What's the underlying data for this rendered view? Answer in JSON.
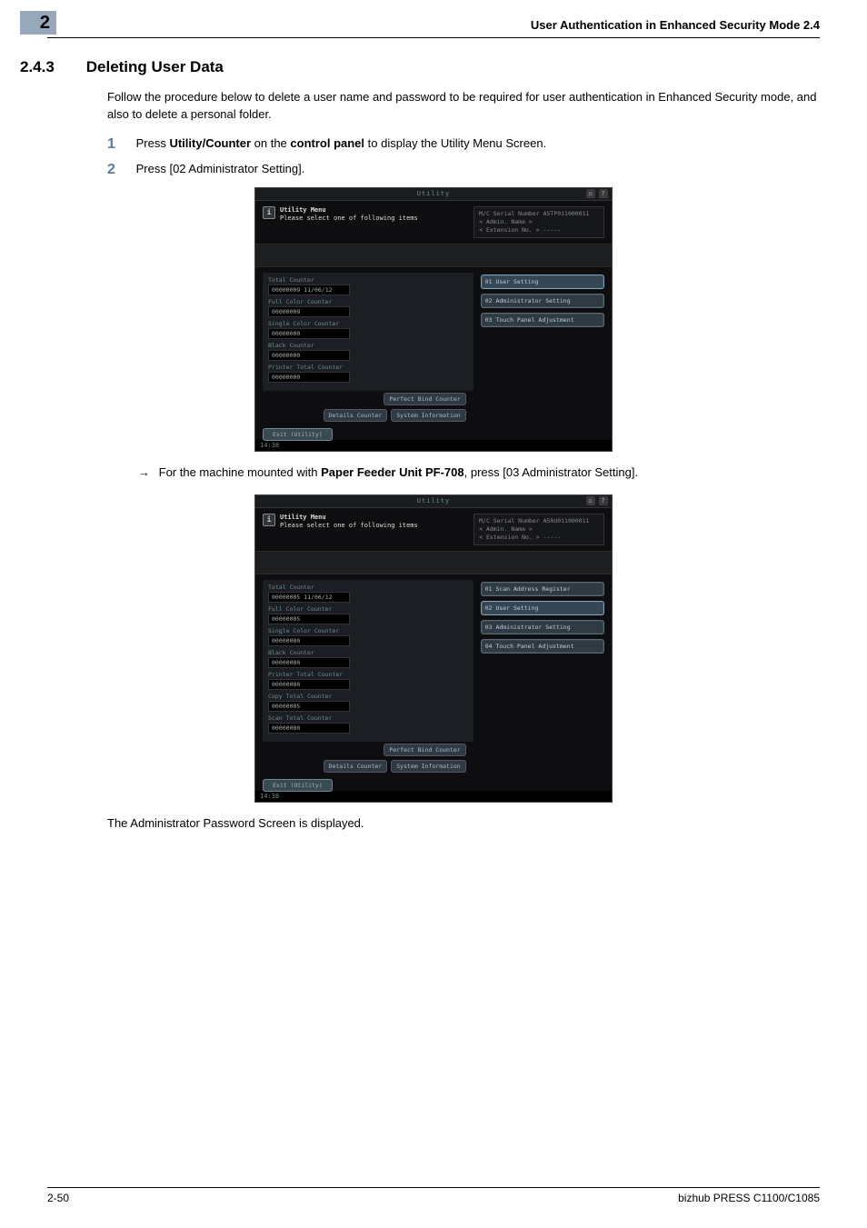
{
  "chapter_number": "2",
  "running_header": "User Authentication in Enhanced Security Mode    2.4",
  "section_number": "2.4.3",
  "section_title": "Deleting User Data",
  "intro": "Follow the procedure below to delete a user name and password to be required for user authentication in Enhanced Security mode, and also to delete a personal folder.",
  "step1_num": "1",
  "step1": {
    "pre": "Press ",
    "bold1": "Utility/Counter",
    "mid": " on the ",
    "bold2": "control panel",
    "post": " to display the Utility Menu Screen."
  },
  "step2_num": "2",
  "step2": "Press [02 Administrator Setting].",
  "arrow_line": {
    "pre": "For the machine mounted with ",
    "bold": "Paper Feeder Unit PF-708",
    "post": ", press [03 Administrator Setting]."
  },
  "result_text": "The Administrator Password Screen is displayed.",
  "footer_left": "2-50",
  "footer_right": "bizhub PRESS C1100/C1085",
  "screen_common": {
    "title": "Utility",
    "head_line1": "Utility Menu",
    "head_line2": "Please select one of following items",
    "info_admin": "< Admin. Name >",
    "info_ext": "< Extension No. >  -----",
    "btn_perfect": "Perfect Bind Counter",
    "btn_details": "Details Counter",
    "btn_sysinfo": "System Information",
    "btn_exit": "Exit (Utility)",
    "time": "14:38"
  },
  "screen1": {
    "serial": "M/C Serial Number  A5TP011000011",
    "counters": [
      {
        "label": "Total Counter",
        "value": "00000009   11/06/12"
      },
      {
        "label": "Full Color Counter",
        "value": "00000009"
      },
      {
        "label": "Single Color Counter",
        "value": "00000000"
      },
      {
        "label": "Black Counter",
        "value": "00000000"
      },
      {
        "label": "Printer Total Counter",
        "value": "00000000"
      }
    ],
    "buttons": [
      {
        "label": "01 User Setting",
        "hi": true
      },
      {
        "label": "02 Administrator Setting",
        "hi": false
      },
      {
        "label": "03 Touch Panel Adjustment",
        "hi": false
      }
    ]
  },
  "screen2": {
    "serial": "M/C Serial Number  A50U011000011",
    "counters": [
      {
        "label": "Total Counter",
        "value": "00000005   11/06/12"
      },
      {
        "label": "Full Color Counter",
        "value": "00000005"
      },
      {
        "label": "Single Color Counter",
        "value": "00000000"
      },
      {
        "label": "Black Counter",
        "value": "00000000"
      },
      {
        "label": "Printer Total Counter",
        "value": "00000000"
      },
      {
        "label": "Copy Total Counter",
        "value": "00000005"
      },
      {
        "label": "Scan Total Counter",
        "value": "00000000"
      }
    ],
    "buttons": [
      {
        "label": "01 Scan Address Register",
        "hi": false
      },
      {
        "label": "02 User Setting",
        "hi": true
      },
      {
        "label": "03 Administrator Setting",
        "hi": false
      },
      {
        "label": "04 Touch Panel Adjustment",
        "hi": false
      }
    ]
  }
}
